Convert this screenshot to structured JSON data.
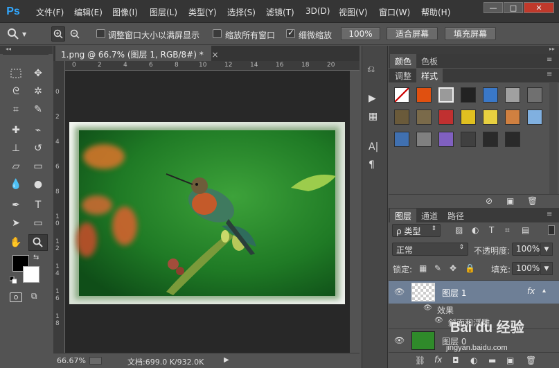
{
  "app": {
    "logo": "Ps"
  },
  "menu": [
    "文件(F)",
    "编辑(E)",
    "图像(I)",
    "图层(L)",
    "类型(Y)",
    "选择(S)",
    "滤镜(T)",
    "3D(D)",
    "视图(V)",
    "窗口(W)",
    "帮助(H)"
  ],
  "window_controls": {
    "minimize": "—",
    "restore": "□",
    "close": "✕"
  },
  "options": {
    "fit_window_label": "调整窗口大小以满屏显示",
    "zoom_all_label": "缩放所有窗口",
    "scrubby_zoom_label": "细微缩放",
    "zoom_100": "100%",
    "fit_screen": "适合屏幕",
    "fill_screen": "填充屏幕",
    "fit_window_checked": false,
    "zoom_all_checked": false,
    "scrubby_checked": true
  },
  "document": {
    "tab_title": "1.png @ 66.7% (图层 1, RGB/8#) *",
    "close": "×",
    "ruler_h": [
      "0",
      "2",
      "4",
      "6",
      "8",
      "10",
      "12",
      "14",
      "16",
      "18",
      "20"
    ],
    "ruler_v": [
      "0",
      "2",
      "4",
      "6",
      "8",
      "1 0",
      "1 2",
      "1 4",
      "1 6",
      "1 8"
    ]
  },
  "status": {
    "zoom": "66.67%",
    "doc_size": "文档:699.0 K/932.0K",
    "arrow": "▶"
  },
  "panels": {
    "color_tab": "颜色",
    "swatches_tab": "色板",
    "adjust_tab": "调整",
    "styles_tab": "样式",
    "layers_tab": "图层",
    "channels_tab": "通道",
    "paths_tab": "路径",
    "filter_kind": "ρ 类型",
    "blend_mode": "正常",
    "opacity_label": "不透明度:",
    "opacity_value": "100%",
    "lock_label": "锁定:",
    "fill_label": "填充:",
    "fill_value": "100%",
    "layers": [
      {
        "name": "图层 1",
        "fx": "fx"
      },
      {
        "name": "图层 0"
      }
    ],
    "effects_label": "效果",
    "bevel_label": "斜面和浮雕"
  },
  "styles_swatches": [
    "#c83030",
    "#e05010",
    "#9a9a9a",
    "#222222",
    "#3a78c8",
    "#a0a0a0",
    "#707070",
    "#6a5a3a",
    "#7a6a4a",
    "#c03030",
    "#e0c020",
    "#e8d040",
    "#d08040",
    "#80b0e0",
    "#4070b0",
    "#808080",
    "#8060c0",
    "#404040",
    "#2a2a2a",
    "#2a2a2a"
  ],
  "watermark": {
    "brand": "Bai du 经验",
    "url": "jingyan.baidu.com"
  }
}
